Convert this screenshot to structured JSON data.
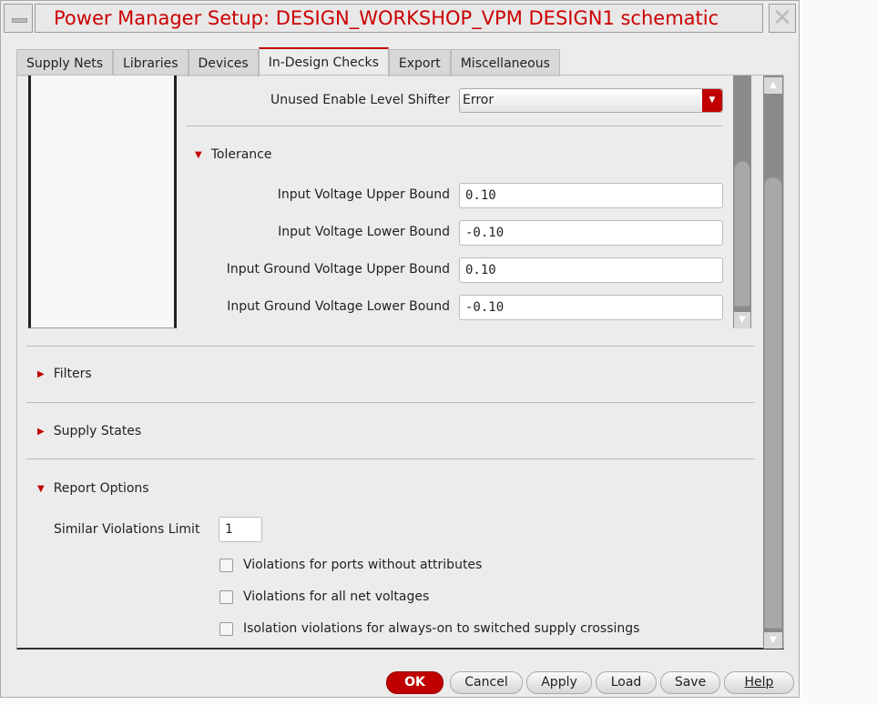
{
  "window": {
    "title": "Power Manager Setup: DESIGN_WORKSHOP_VPM DESIGN1 schematic",
    "close": "✕",
    "minimize": "—"
  },
  "tabs": [
    {
      "label": "Supply Nets"
    },
    {
      "label": "Libraries"
    },
    {
      "label": "Devices"
    },
    {
      "label": "In-Design Checks"
    },
    {
      "label": "Export"
    },
    {
      "label": "Miscellaneous"
    }
  ],
  "checks": {
    "unused_enable_label": "Unused Enable Level Shifter",
    "unused_enable_value": "Error"
  },
  "tolerance": {
    "title": "Tolerance",
    "fields": [
      {
        "label": "Input Voltage Upper Bound",
        "value": "0.10"
      },
      {
        "label": "Input Voltage Lower Bound",
        "value": "-0.10"
      },
      {
        "label": "Input Ground Voltage Upper Bound",
        "value": "0.10"
      },
      {
        "label": "Input Ground Voltage Lower Bound",
        "value": "-0.10"
      }
    ]
  },
  "sections": {
    "filters": "Filters",
    "supply_states": "Supply States",
    "report_options": "Report Options"
  },
  "report": {
    "limit_label": "Similar Violations Limit",
    "limit_value": "1",
    "checkboxes": [
      {
        "label": "Violations for ports without attributes",
        "checked": false
      },
      {
        "label": "Violations for all net voltages",
        "checked": false
      },
      {
        "label": "Isolation violations for always-on to switched supply crossings",
        "checked": false
      }
    ]
  },
  "buttons": {
    "ok": "OK",
    "cancel": "Cancel",
    "apply": "Apply",
    "load": "Load",
    "save": "Save",
    "help": "Help"
  }
}
